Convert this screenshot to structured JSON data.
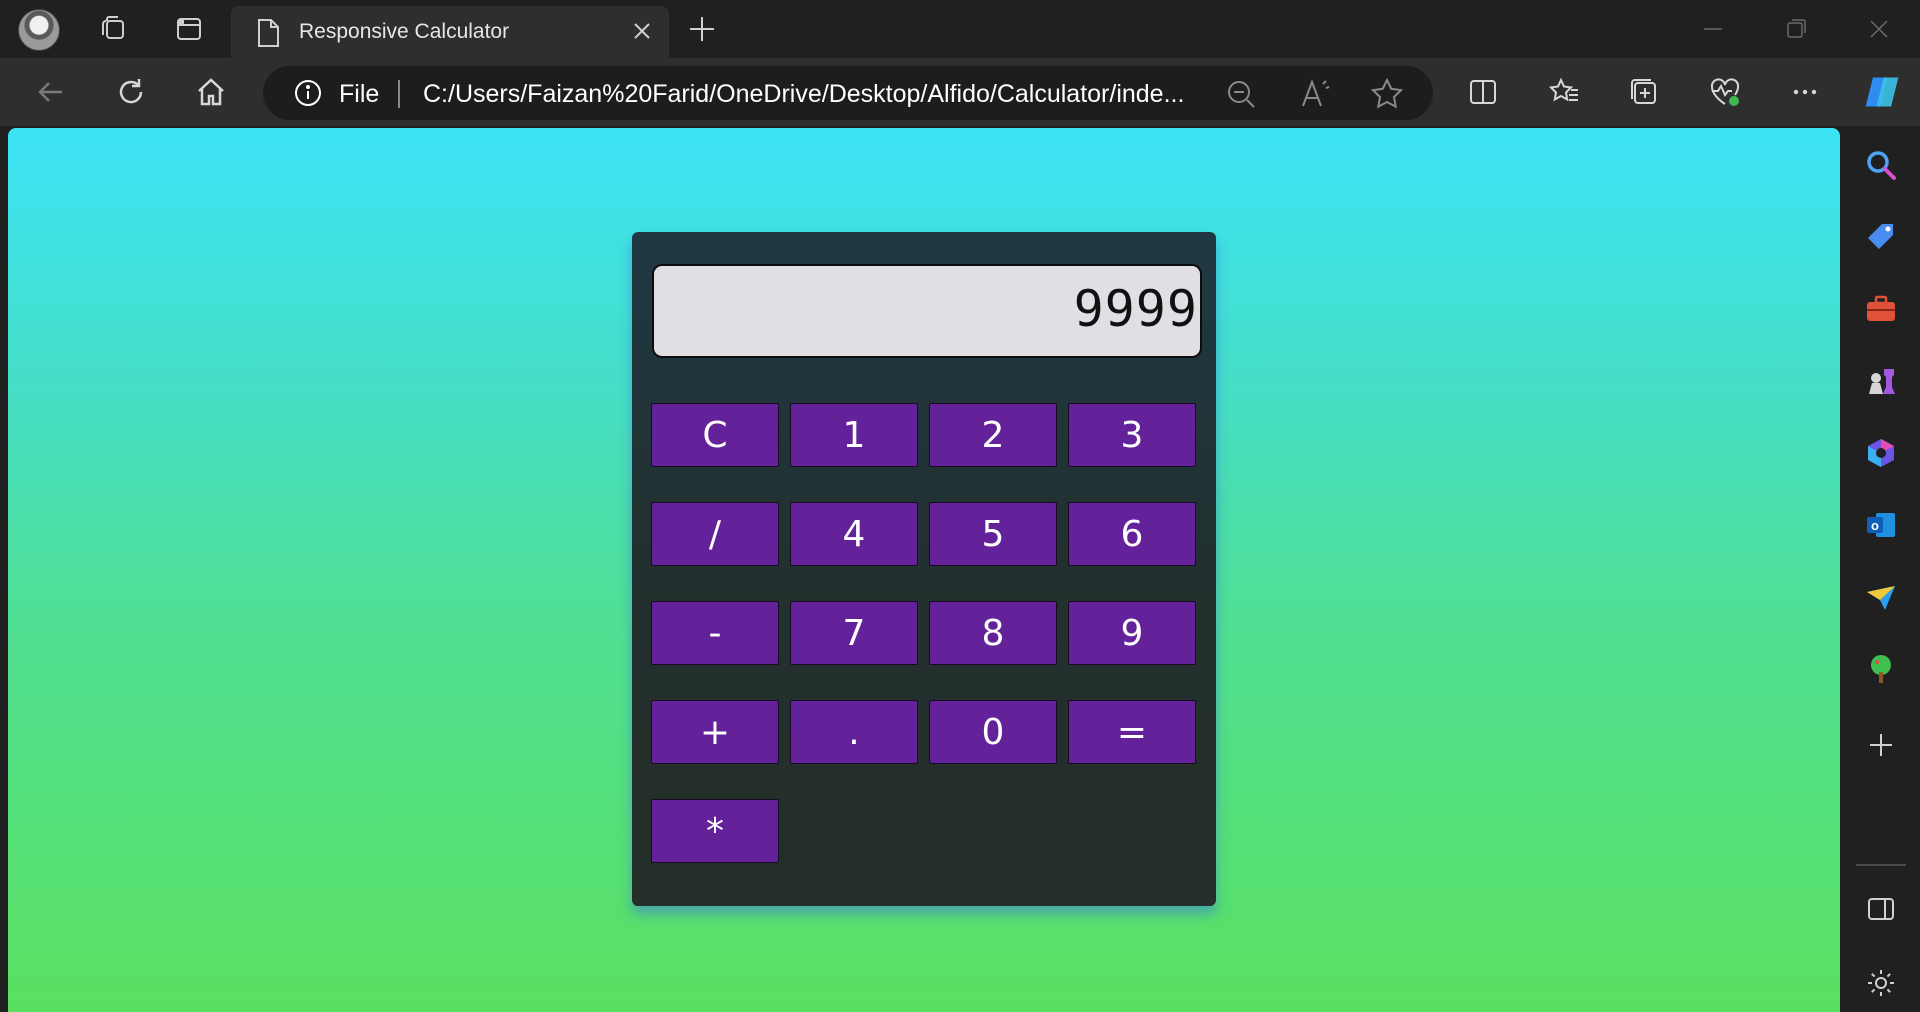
{
  "browser": {
    "tab_title": "Responsive Calculator",
    "omnibox": {
      "scheme_label": "File",
      "url": "C:/Users/Faizan%20Farid/OneDrive/Desktop/Alfido/Calculator/inde..."
    }
  },
  "calculator": {
    "display_value": "9999",
    "keys": {
      "clear": "C",
      "one": "1",
      "two": "2",
      "three": "3",
      "divide": "/",
      "four": "4",
      "five": "5",
      "six": "6",
      "minus": "-",
      "seven": "7",
      "eight": "8",
      "nine": "9",
      "plus": "+",
      "decimal": ".",
      "zero": "0",
      "equals": "=",
      "multiply": "*"
    }
  }
}
